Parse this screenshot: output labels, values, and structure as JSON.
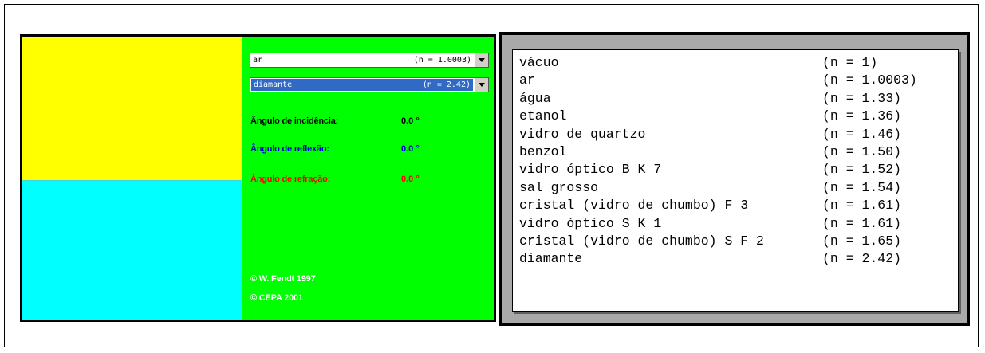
{
  "applet": {
    "combo_top": {
      "material": "ar",
      "index": "(n = 1.0003)"
    },
    "combo_bottom": {
      "material": "diamante",
      "index": "(n = 2.42)"
    },
    "incidence": {
      "label": "Ângulo de incidência:",
      "value": "0.0 °"
    },
    "reflection": {
      "label": "Ângulo de reflexão:",
      "value": "0.0 °"
    },
    "refraction": {
      "label": "Ângulo de refração:",
      "value": "0.0 °"
    },
    "copyright_1": "© W. Fendt 1997",
    "copyright_2": "© CEPA 2001"
  },
  "materials": [
    {
      "name": "vácuo",
      "index": "(n = 1)"
    },
    {
      "name": "ar",
      "index": "(n = 1.0003)"
    },
    {
      "name": "água",
      "index": "(n = 1.33)"
    },
    {
      "name": "etanol",
      "index": "(n = 1.36)"
    },
    {
      "name": "vidro de quartzo",
      "index": "(n = 1.46)"
    },
    {
      "name": "benzol",
      "index": "(n = 1.50)"
    },
    {
      "name": "vidro óptico B K 7",
      "index": "(n = 1.52)"
    },
    {
      "name": "sal grosso",
      "index": "(n = 1.54)"
    },
    {
      "name": "cristal (vidro de chumbo) F 3",
      "index": "(n = 1.61)"
    },
    {
      "name": "vidro óptico S K 1",
      "index": "(n = 1.61)"
    },
    {
      "name": "cristal (vidro de chumbo) S F 2",
      "index": "(n = 1.65)"
    },
    {
      "name": "diamante",
      "index": "(n = 2.42)"
    }
  ],
  "colors": {
    "medium_top": "#ffff00",
    "medium_bottom": "#00ffff",
    "panel": "#00ff00",
    "normal_line": "#ff0000",
    "reflection_text": "#0000cc",
    "refraction_text": "#ff0000"
  },
  "icons": {
    "combo_arrow": "chevron-down-icon"
  }
}
